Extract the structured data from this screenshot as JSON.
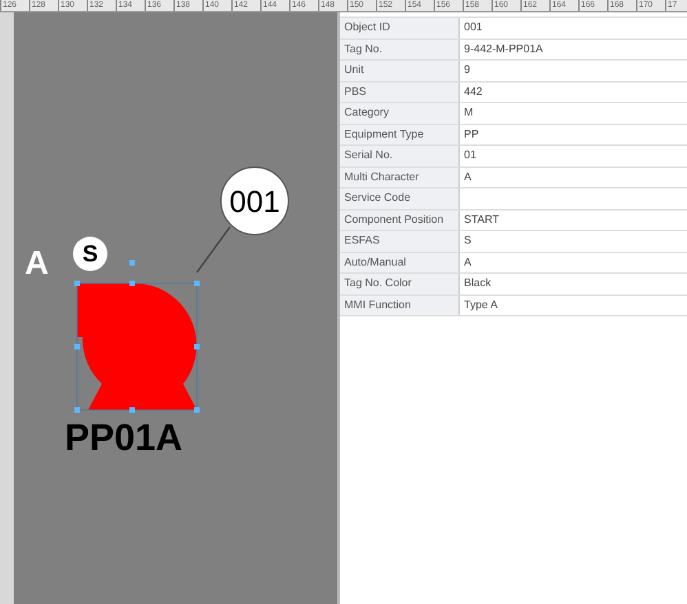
{
  "ruler": [
    "126",
    "128",
    "130",
    "132",
    "134",
    "136",
    "138",
    "140",
    "142",
    "144",
    "146",
    "148",
    "150",
    "152",
    "154",
    "156",
    "158",
    "160",
    "162",
    "164",
    "166",
    "168",
    "170",
    "17"
  ],
  "canvas": {
    "multi_character": "A",
    "esfas": "S",
    "balloon": "001",
    "tag": "PP01A",
    "symbol": {
      "kind": "pump",
      "color": "#ff0000",
      "selected": true
    }
  },
  "properties": [
    {
      "name": "Object ID",
      "value": "001"
    },
    {
      "name": "Tag No.",
      "value": "9-442-M-PP01A"
    },
    {
      "name": "Unit",
      "value": "9"
    },
    {
      "name": "PBS",
      "value": "442"
    },
    {
      "name": "Category",
      "value": "M"
    },
    {
      "name": "Equipment Type",
      "value": "PP"
    },
    {
      "name": "Serial No.",
      "value": "01"
    },
    {
      "name": "Multi Character",
      "value": "A"
    },
    {
      "name": "Service Code"
    },
    {
      "name": "Component Position",
      "value": "START"
    },
    {
      "name": "ESFAS",
      "value": "S"
    },
    {
      "name": "Auto/Manual",
      "value": "A"
    },
    {
      "name": "Tag No. Color",
      "value": "Black"
    },
    {
      "name": "MMI Function",
      "value": "Type A"
    }
  ]
}
